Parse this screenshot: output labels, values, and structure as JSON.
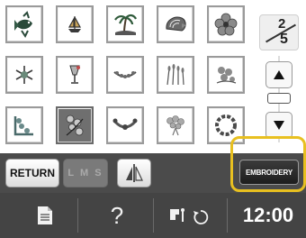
{
  "page_indicator": {
    "current": "2",
    "total": "5"
  },
  "pattern_grid": {
    "rows": [
      [
        {
          "icon": "fish-embroidery-icon"
        },
        {
          "icon": "sailboat-embroidery-icon"
        },
        {
          "icon": "palm-island-embroidery-icon"
        },
        {
          "icon": "seashell-embroidery-icon"
        },
        {
          "icon": "hibiscus-embroidery-icon"
        }
      ],
      [
        {
          "icon": "snowflake-embroidery-icon"
        },
        {
          "icon": "glass-embroidery-icon"
        },
        {
          "icon": "garland-embroidery-icon"
        },
        {
          "icon": "wheat-embroidery-icon"
        },
        {
          "icon": "floral-spray-embroidery-icon"
        }
      ],
      [
        {
          "icon": "corner-floral-embroidery-icon"
        },
        {
          "icon": "selected-floral-embroidery-icon",
          "selected": true
        },
        {
          "icon": "swag-embroidery-icon"
        },
        {
          "icon": "bouquet-embroidery-icon"
        },
        {
          "icon": "wreath-embroidery-icon"
        }
      ]
    ]
  },
  "toolbar": {
    "return_label": "RETURN",
    "lms_label": "L M S",
    "embroidery_label": "EMBROIDERY"
  },
  "statusbar": {
    "help_label": "?",
    "time": "12:00"
  },
  "colors": {
    "toolbar_bg": "#4b4b4b",
    "highlight": "#e8c020",
    "selected_cell": "#6f6f6f"
  }
}
